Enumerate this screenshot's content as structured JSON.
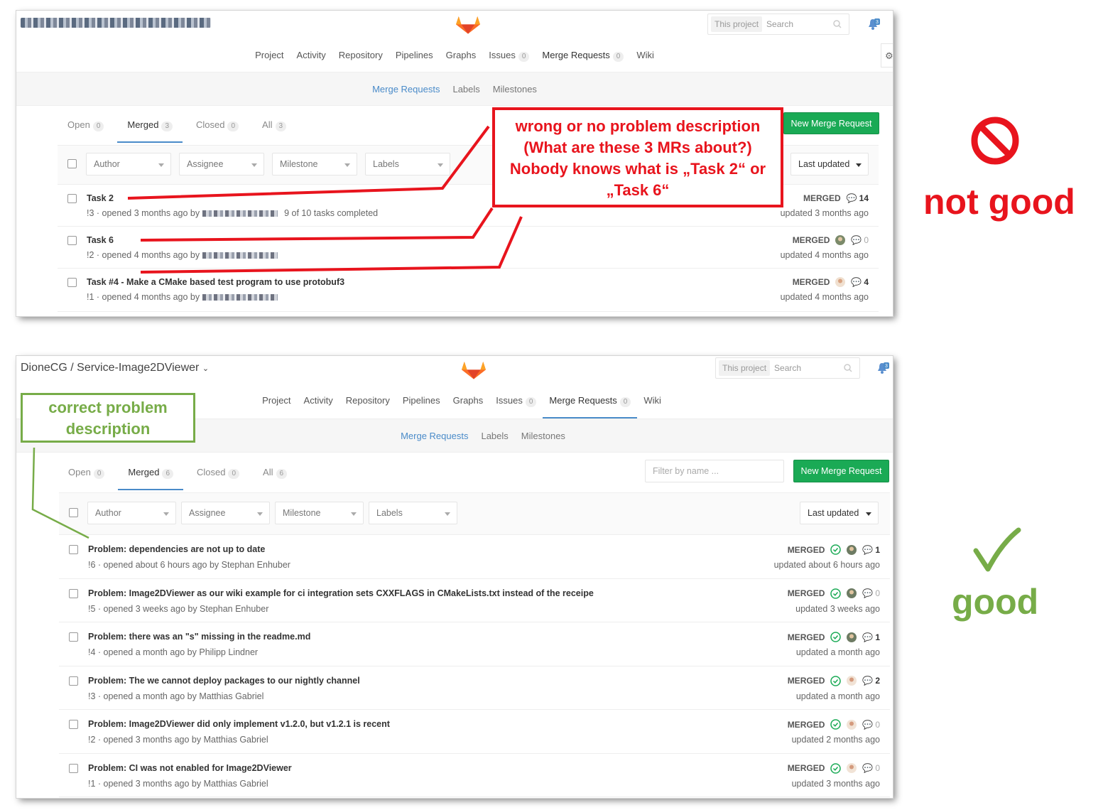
{
  "top": {
    "title": "",
    "search_scope": "This project",
    "search_placeholder": "Search",
    "notification_count": "3",
    "nav": [
      {
        "label": "Project"
      },
      {
        "label": "Activity"
      },
      {
        "label": "Repository"
      },
      {
        "label": "Pipelines"
      },
      {
        "label": "Graphs"
      },
      {
        "label": "Issues",
        "count": "0"
      },
      {
        "label": "Merge Requests",
        "count": "0"
      },
      {
        "label": "Wiki"
      }
    ],
    "subnav": [
      "Merge Requests",
      "Labels",
      "Milestones"
    ],
    "states": [
      {
        "label": "Open",
        "count": "0"
      },
      {
        "label": "Merged",
        "count": "3"
      },
      {
        "label": "Closed",
        "count": "0"
      },
      {
        "label": "All",
        "count": "3"
      }
    ],
    "new_mr_label": "New Merge Request",
    "filters": [
      "Author",
      "Assignee",
      "Milestone",
      "Labels"
    ],
    "sort_label": "Last updated",
    "mrs": [
      {
        "title": "Task 2",
        "meta_prefix": "!3 · opened 3 months ago by",
        "meta_suffix": "9 of 10 tasks completed",
        "status": "MERGED",
        "comments": "14",
        "updated": "updated 3 months ago"
      },
      {
        "title": "Task 6",
        "meta_prefix": "!2 · opened 4 months ago by",
        "meta_suffix": "",
        "status": "MERGED",
        "comments": "0",
        "updated": "updated 4 months ago"
      },
      {
        "title": "Task #4 - Make a CMake based test program to use protobuf3",
        "meta_prefix": "!1 · opened 4 months ago by",
        "meta_suffix": "",
        "status": "MERGED",
        "comments": "4",
        "updated": "updated 4 months ago"
      }
    ],
    "annotation": {
      "line1": "wrong or no problem description",
      "line2": "(What are these 3 MRs about?)",
      "line3": "Nobody knows what is „Task 2“ or",
      "line4": "„Task 6“"
    },
    "verdict": "not good"
  },
  "bottom": {
    "title": "DioneCG / Service-Image2DViewer",
    "search_scope": "This project",
    "search_placeholder": "Search",
    "notification_count": "3",
    "nav": [
      {
        "label": "Project"
      },
      {
        "label": "Activity"
      },
      {
        "label": "Repository"
      },
      {
        "label": "Pipelines"
      },
      {
        "label": "Graphs"
      },
      {
        "label": "Issues",
        "count": "0"
      },
      {
        "label": "Merge Requests",
        "count": "0"
      },
      {
        "label": "Wiki"
      }
    ],
    "subnav": [
      "Merge Requests",
      "Labels",
      "Milestones"
    ],
    "states": [
      {
        "label": "Open",
        "count": "0"
      },
      {
        "label": "Merged",
        "count": "6"
      },
      {
        "label": "Closed",
        "count": "0"
      },
      {
        "label": "All",
        "count": "6"
      }
    ],
    "filter_placeholder": "Filter by name ...",
    "new_mr_label": "New Merge Request",
    "filters": [
      "Author",
      "Assignee",
      "Milestone",
      "Labels"
    ],
    "sort_label": "Last updated",
    "mrs": [
      {
        "title": "Problem: dependencies are not up to date",
        "meta": "!6 · opened about 6 hours ago by Stephan Enhuber",
        "status": "MERGED",
        "comments": "1",
        "updated": "updated about 6 hours ago"
      },
      {
        "title": "Problem: Image2DViewer as our wiki example for ci integration sets CXXFLAGS in CMakeLists.txt instead of the receipe",
        "meta": "!5 · opened 3 weeks ago by Stephan Enhuber",
        "status": "MERGED",
        "comments": "0",
        "updated": "updated 3 weeks ago"
      },
      {
        "title": "Problem: there was an \"s\" missing in the readme.md",
        "meta": "!4 · opened a month ago by Philipp Lindner",
        "status": "MERGED",
        "comments": "1",
        "updated": "updated a month ago"
      },
      {
        "title": "Problem: The we cannot deploy packages to our nightly channel",
        "meta": "!3 · opened a month ago by Matthias Gabriel",
        "status": "MERGED",
        "comments": "2",
        "updated": "updated a month ago"
      },
      {
        "title": "Problem: Image2DViewer did only implement v1.2.0, but v1.2.1 is recent",
        "meta": "!2 · opened 3 months ago by Matthias Gabriel",
        "status": "MERGED",
        "comments": "0",
        "updated": "updated 2 months ago"
      },
      {
        "title": "Problem: CI was not enabled for Image2DViewer",
        "meta": "!1 · opened 3 months ago by Matthias Gabriel",
        "status": "MERGED",
        "comments": "0",
        "updated": "updated 3 months ago"
      }
    ],
    "annotation": {
      "line1": "correct problem",
      "line2": "description"
    },
    "verdict": "good"
  },
  "colors": {
    "bad": "#e8141d",
    "good": "#77ac48",
    "merge_button": "#1aaa55",
    "active_tab": "#4a8bc9"
  },
  "icons": [
    "gitlab-logo-icon",
    "search-icon",
    "bell-icon",
    "gear-icon",
    "comment-icon",
    "pipeline-passed-icon",
    "avatar-icon",
    "prohibited-icon",
    "checkmark-icon"
  ]
}
